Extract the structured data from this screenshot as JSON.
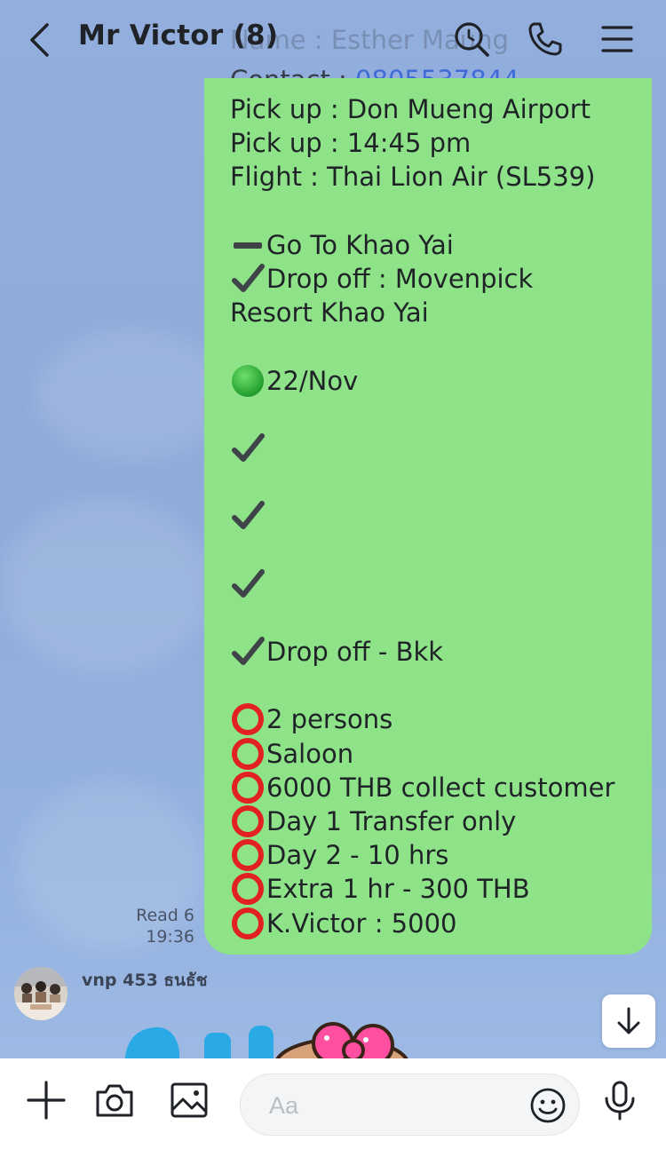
{
  "header": {
    "title": "Mr Victor  (8)",
    "back_icon": "chevron-left-icon",
    "icons": [
      "search-icon",
      "phone-icon",
      "menu-icon"
    ]
  },
  "ghost_lines": [
    "Name : Esther Maung"
  ],
  "message": {
    "contact_label": "Contact : ",
    "contact_number": "0805537844",
    "lines": [
      {
        "emoji": "",
        "text": "Pick up : Don Mueng Airport"
      },
      {
        "emoji": "",
        "text": "Pick up : 14:45 pm"
      },
      {
        "emoji": "",
        "text": "Flight : Thai Lion Air (SL539)"
      },
      {
        "emoji": "",
        "text": ""
      },
      {
        "emoji": "minus",
        "text": "Go To Khao Yai"
      },
      {
        "emoji": "check",
        "text": "Drop off : Movenpick"
      },
      {
        "emoji": "",
        "text": "Resort Khao Yai"
      },
      {
        "emoji": "",
        "text": ""
      },
      {
        "emoji": "green-circle",
        "text": "22/Nov"
      },
      {
        "emoji": "",
        "text": ""
      },
      {
        "emoji": "check",
        "text": ""
      },
      {
        "emoji": "",
        "text": ""
      },
      {
        "emoji": "check",
        "text": ""
      },
      {
        "emoji": "",
        "text": ""
      },
      {
        "emoji": "check",
        "text": ""
      },
      {
        "emoji": "",
        "text": ""
      },
      {
        "emoji": "check",
        "text": "Drop off - Bkk"
      },
      {
        "emoji": "",
        "text": ""
      },
      {
        "emoji": "red-ring",
        "text": "2 persons"
      },
      {
        "emoji": "red-ring",
        "text": "Saloon"
      },
      {
        "emoji": "red-ring",
        "text": "6000 THB collect customer"
      },
      {
        "emoji": "red-ring",
        "text": "Day 1 Transfer only"
      },
      {
        "emoji": "red-ring",
        "text": "Day 2 - 10 hrs"
      },
      {
        "emoji": "red-ring",
        "text": "Extra 1 hr - 300 THB"
      },
      {
        "emoji": "red-ring",
        "text": "K.Victor : 5000"
      }
    ],
    "read_status": "Read 6",
    "time": "19:36",
    "bubble_color": "#8ee388"
  },
  "next_message": {
    "sender": "vnp 453 ธนธัช"
  },
  "composer": {
    "placeholder": "Aa",
    "icons": [
      "plus-icon",
      "camera-icon",
      "image-icon",
      "emoji-icon",
      "microphone-icon"
    ]
  },
  "scroll_down_icon": "arrow-down-icon"
}
